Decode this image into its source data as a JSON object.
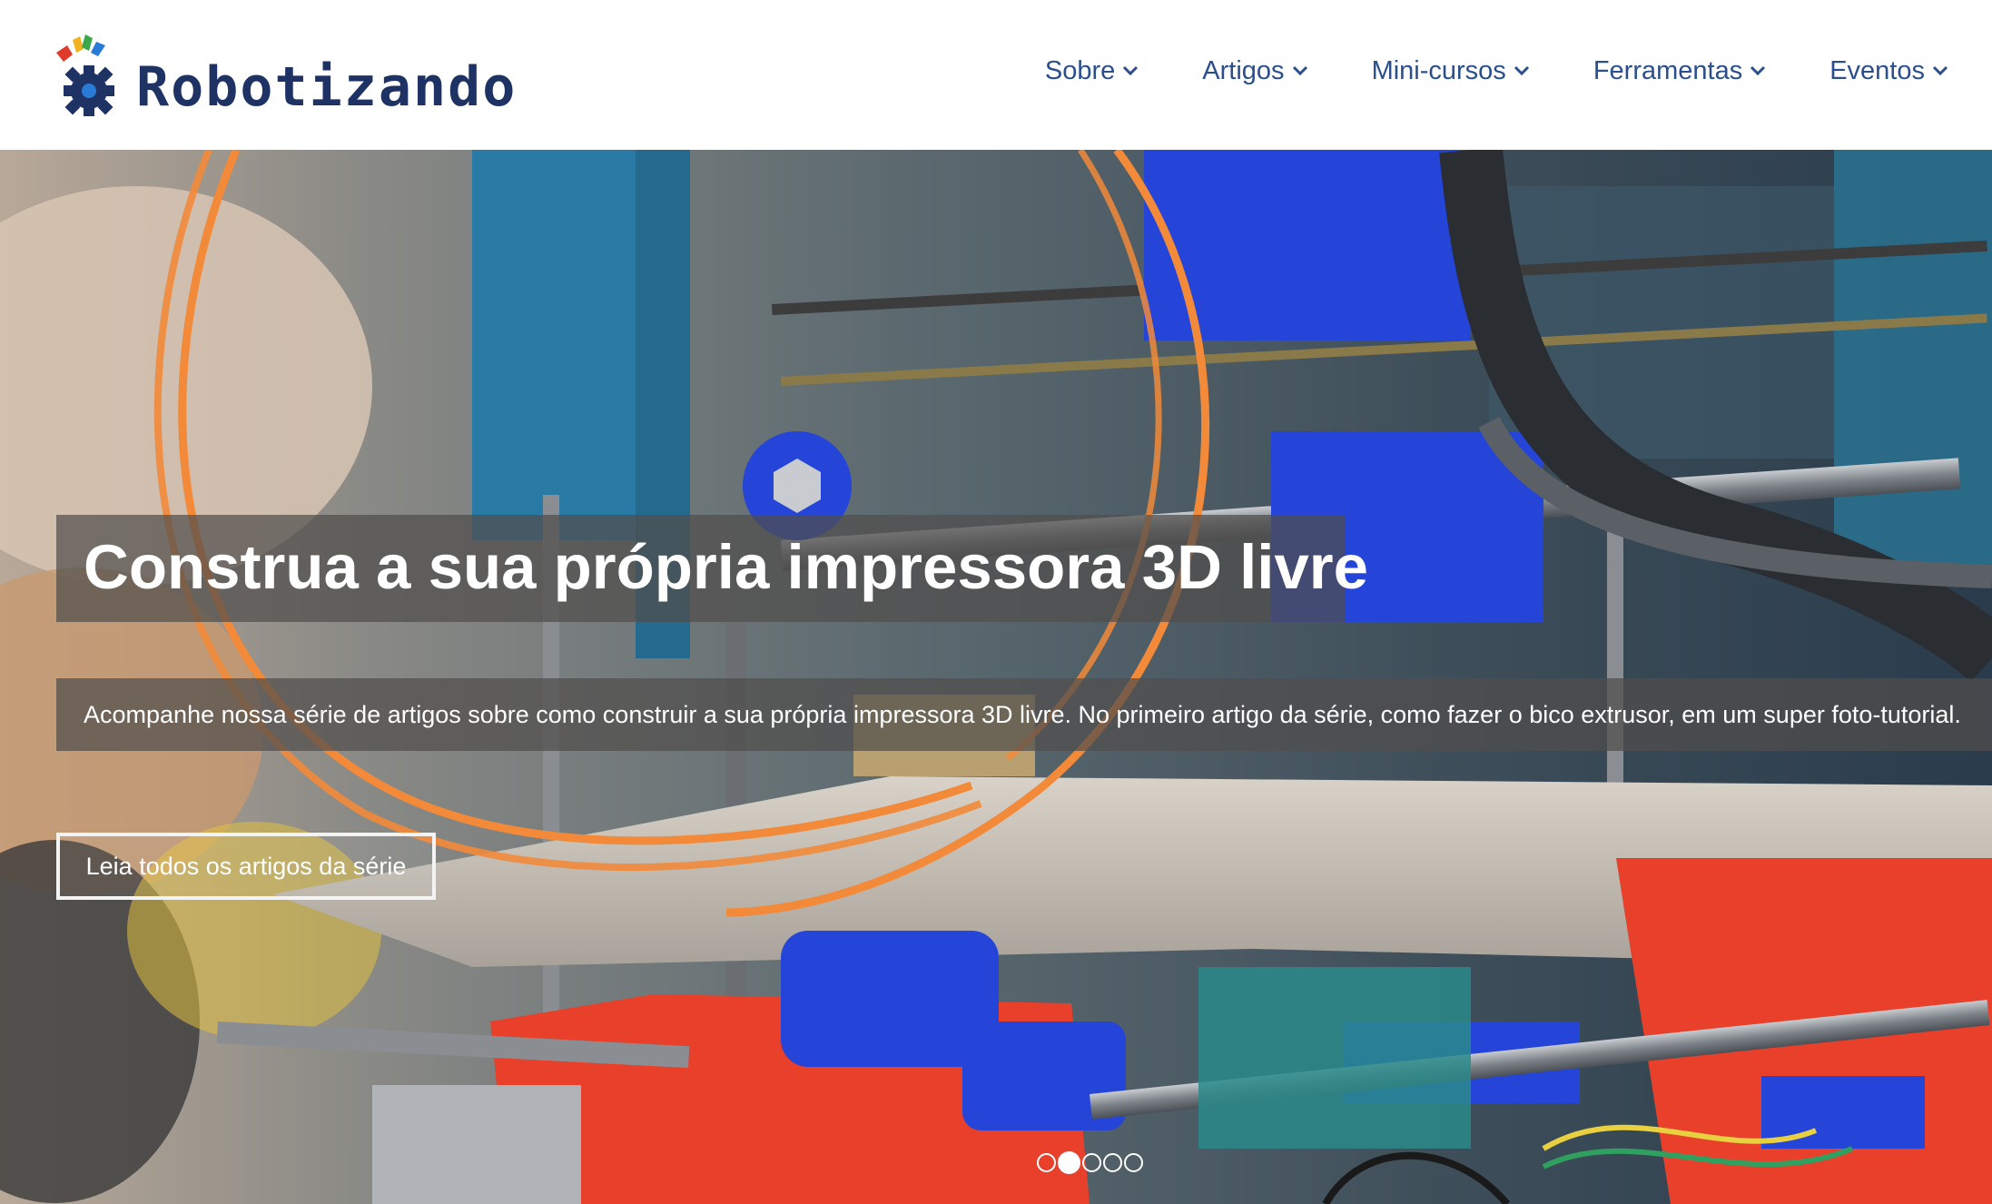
{
  "logo": {
    "text": "Robotizando",
    "icon": "gear-logo-icon"
  },
  "nav": {
    "items": [
      {
        "label": "Sobre",
        "icon": "chevron-down-icon"
      },
      {
        "label": "Artigos",
        "icon": "chevron-down-icon"
      },
      {
        "label": "Mini-cursos",
        "icon": "chevron-down-icon"
      },
      {
        "label": "Ferramentas",
        "icon": "chevron-down-icon"
      },
      {
        "label": "Eventos",
        "icon": "chevron-down-icon"
      }
    ]
  },
  "hero": {
    "title": "Construa a sua própria impressora 3D livre",
    "description": "Acompanhe nossa série de artigos sobre como construir a sua própria impressora 3D livre. No primeiro artigo da série, como fazer o bico extrusor, em um super foto-tutorial.",
    "cta_label": "Leia todos os artigos da série",
    "slides": {
      "total": 5,
      "active_index": 1
    }
  },
  "colors": {
    "brand_navy": "#1e3264",
    "nav_text": "#2a4f8c",
    "caption_bg": "#504e4c",
    "filament_orange": "#f28a3a",
    "printer_blue": "#2544d8",
    "printer_red": "#e8402a",
    "printer_teal": "#2a7a9a"
  }
}
